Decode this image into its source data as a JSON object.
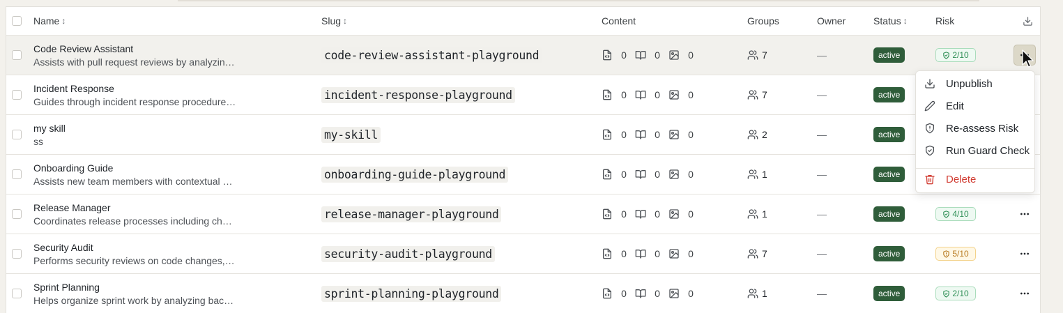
{
  "header": {
    "name": "Name",
    "slug": "Slug",
    "content": "Content",
    "groups": "Groups",
    "owner": "Owner",
    "status": "Status",
    "risk": "Risk",
    "sort_glyph": "↕"
  },
  "rows": [
    {
      "name": "Code Review Assistant",
      "desc": "Assists with pull request reviews by analyzin…",
      "slug": "code-review-assistant-playground",
      "c1": "0",
      "c2": "0",
      "c3": "0",
      "groups": "7",
      "owner": "—",
      "status": "active",
      "risk": "2/10",
      "risk_level": "green"
    },
    {
      "name": "Incident Response",
      "desc": "Guides through incident response procedure…",
      "slug": "incident-response-playground",
      "c1": "0",
      "c2": "0",
      "c3": "0",
      "groups": "7",
      "owner": "—",
      "status": "active",
      "risk": "",
      "risk_level": ""
    },
    {
      "name": "my skill",
      "desc": "ss",
      "slug": "my-skill",
      "c1": "0",
      "c2": "0",
      "c3": "0",
      "groups": "2",
      "owner": "—",
      "status": "active",
      "risk": "",
      "risk_level": ""
    },
    {
      "name": "Onboarding Guide",
      "desc": "Assists new team members with contextual …",
      "slug": "onboarding-guide-playground",
      "c1": "0",
      "c2": "0",
      "c3": "0",
      "groups": "1",
      "owner": "—",
      "status": "active",
      "risk": "",
      "risk_level": ""
    },
    {
      "name": "Release Manager",
      "desc": "Coordinates release processes including ch…",
      "slug": "release-manager-playground",
      "c1": "0",
      "c2": "0",
      "c3": "0",
      "groups": "1",
      "owner": "—",
      "status": "active",
      "risk": "4/10",
      "risk_level": "green"
    },
    {
      "name": "Security Audit",
      "desc": "Performs security reviews on code changes,…",
      "slug": "security-audit-playground",
      "c1": "0",
      "c2": "0",
      "c3": "0",
      "groups": "7",
      "owner": "—",
      "status": "active",
      "risk": "5/10",
      "risk_level": "amber"
    },
    {
      "name": "Sprint Planning",
      "desc": "Helps organize sprint work by analyzing bac…",
      "slug": "sprint-planning-playground",
      "c1": "0",
      "c2": "0",
      "c3": "0",
      "groups": "1",
      "owner": "—",
      "status": "active",
      "risk": "2/10",
      "risk_level": "green"
    }
  ],
  "menu": {
    "unpublish": "Unpublish",
    "edit": "Edit",
    "reassess": "Re-assess Risk",
    "guard": "Run Guard Check",
    "delete": "Delete"
  },
  "colors": {
    "status_bg": "#2f5d3a",
    "risk_green": "#2f8f56",
    "risk_amber": "#b7791f",
    "danger": "#d13c32"
  },
  "icons": {
    "content": [
      "file-code-icon",
      "book-open-icon",
      "image-icon"
    ],
    "groups": "users-icon",
    "header_action": "download-icon",
    "row_action": "more-horizontal-icon"
  }
}
